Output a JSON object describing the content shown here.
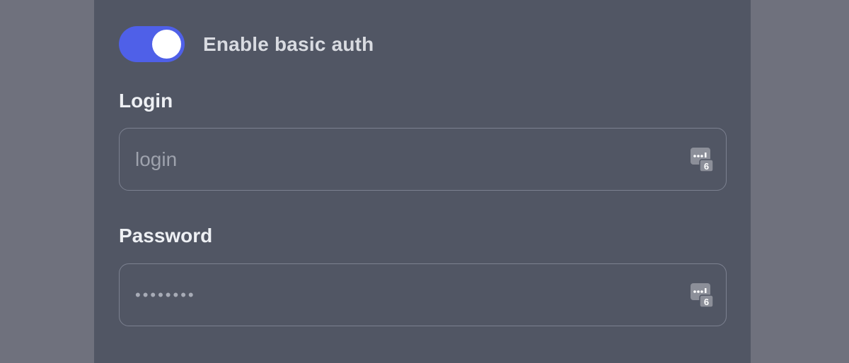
{
  "auth_toggle": {
    "label": "Enable basic auth",
    "enabled": true,
    "accent_color": "#4f60e8"
  },
  "login_field": {
    "label": "Login",
    "placeholder": "login",
    "value": "",
    "icon": "password-manager-icon"
  },
  "password_field": {
    "label": "Password",
    "value": "••••••••",
    "icon": "password-manager-icon",
    "icon_badge": "6"
  }
}
